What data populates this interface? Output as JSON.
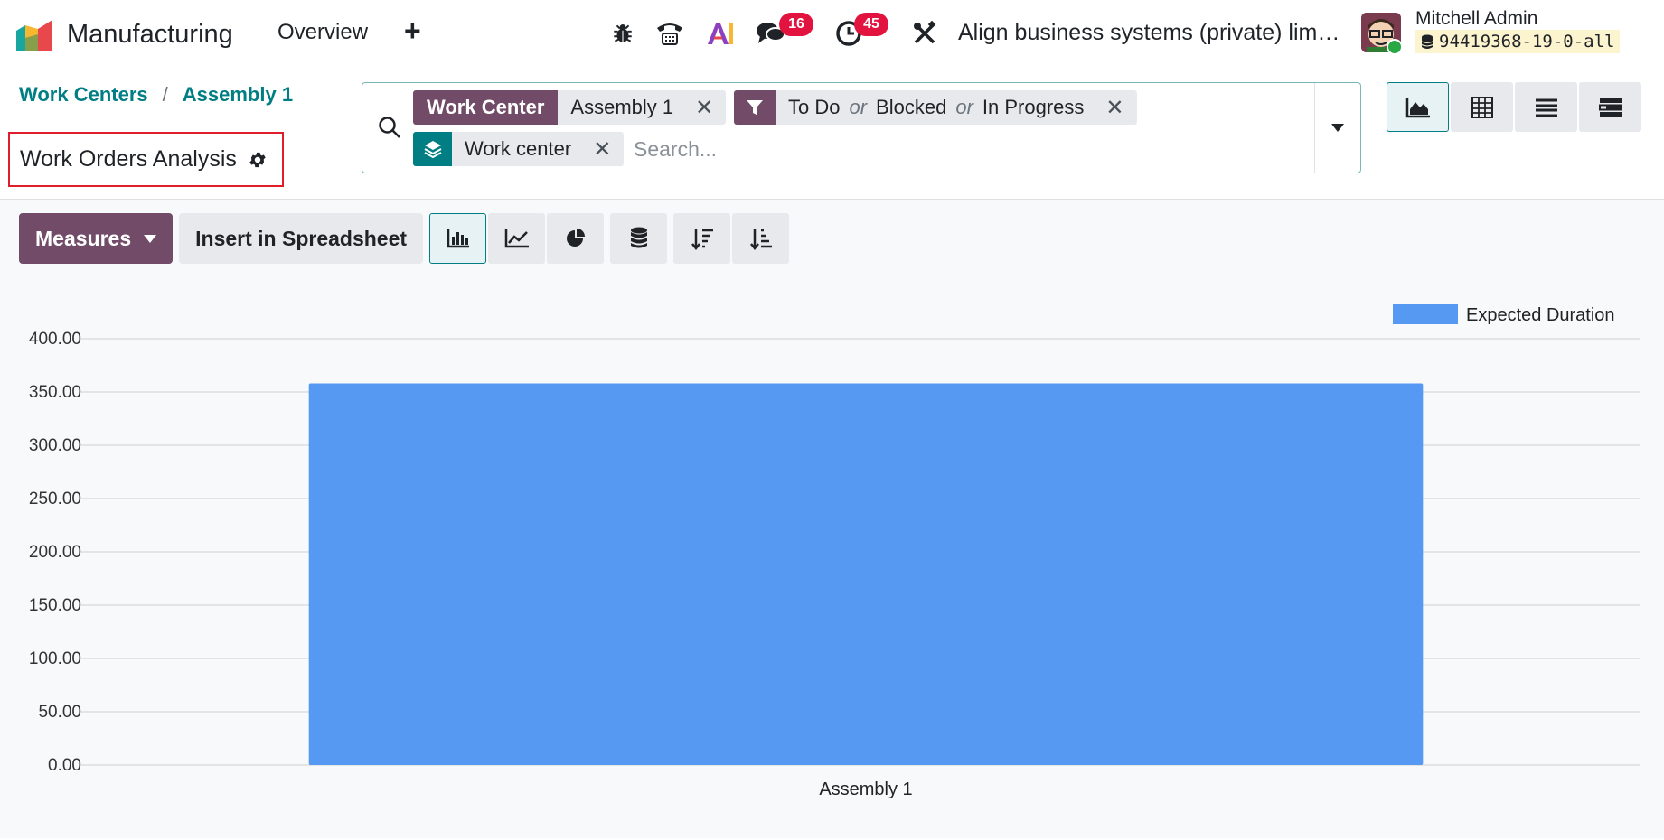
{
  "app": {
    "name": "Manufacturing",
    "nav_overview": "Overview",
    "nav_plus": "+"
  },
  "systray": {
    "messages_count": "16",
    "activities_count": "45",
    "company": "Align business systems (private) lim…",
    "user_name": "Mitchell Admin",
    "database": "94419368-19-0-all"
  },
  "breadcrumb": {
    "parent": "Work Centers",
    "separator": "/",
    "current": "Assembly 1"
  },
  "page": {
    "title": "Work Orders Analysis"
  },
  "search": {
    "facets": [
      {
        "tag": "Work Center",
        "values": [
          "Assembly 1"
        ]
      },
      {
        "tag": "filter",
        "values": [
          "To Do",
          "Blocked",
          "In Progress"
        ],
        "joiner": "or"
      },
      {
        "tag": "groupby",
        "values": [
          "Work center"
        ]
      }
    ],
    "placeholder": "Search..."
  },
  "toolbar": {
    "measures_label": "Measures",
    "insert_label": "Insert in Spreadsheet"
  },
  "colors": {
    "brand": "#714b67",
    "teal": "#017e84",
    "bar": "#5599f2",
    "badge": "#e2133f"
  },
  "chart_data": {
    "type": "bar",
    "categories": [
      "Assembly 1"
    ],
    "series": [
      {
        "name": "Expected Duration",
        "values": [
          358
        ]
      }
    ],
    "ylim": [
      0,
      400
    ],
    "yticks": [
      "0.00",
      "50.00",
      "100.00",
      "150.00",
      "200.00",
      "250.00",
      "300.00",
      "350.00",
      "400.00"
    ],
    "legend": "top-right",
    "grid": true
  }
}
